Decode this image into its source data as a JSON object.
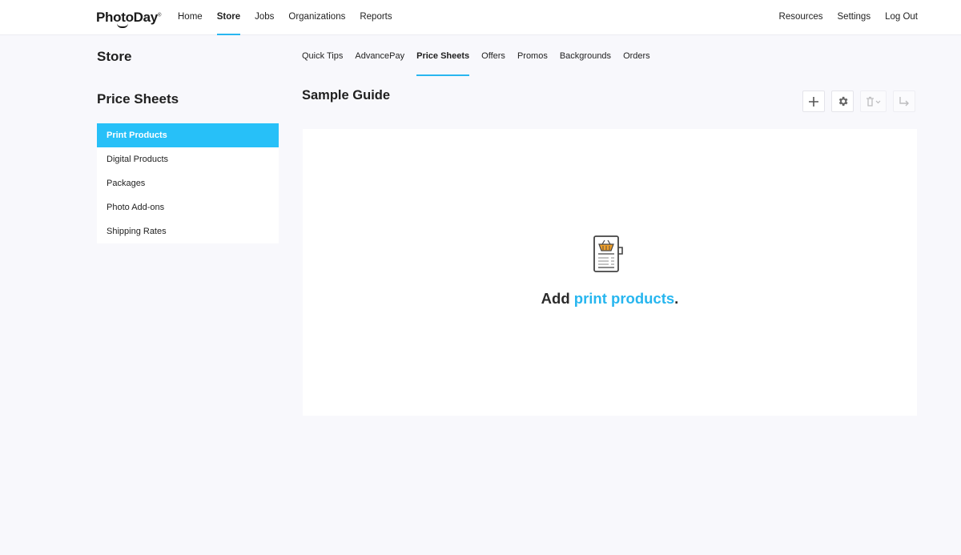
{
  "brand": {
    "name": "PhotoDay",
    "reg": "®"
  },
  "topnav": {
    "main": [
      {
        "label": "Home",
        "active": false
      },
      {
        "label": "Store",
        "active": true
      },
      {
        "label": "Jobs",
        "active": false
      },
      {
        "label": "Organizations",
        "active": false
      },
      {
        "label": "Reports",
        "active": false
      }
    ],
    "right": [
      {
        "label": "Resources"
      },
      {
        "label": "Settings"
      },
      {
        "label": "Log Out"
      }
    ]
  },
  "header": {
    "title": "Store"
  },
  "subnav": [
    {
      "label": "Quick Tips",
      "active": false
    },
    {
      "label": "AdvancePay",
      "active": false
    },
    {
      "label": "Price Sheets",
      "active": true
    },
    {
      "label": "Offers",
      "active": false
    },
    {
      "label": "Promos",
      "active": false
    },
    {
      "label": "Backgrounds",
      "active": false
    },
    {
      "label": "Orders",
      "active": false
    }
  ],
  "sidebar": {
    "title": "Price Sheets",
    "items": [
      {
        "label": "Print Products",
        "active": true
      },
      {
        "label": "Digital Products",
        "active": false
      },
      {
        "label": "Packages",
        "active": false
      },
      {
        "label": "Photo Add-ons",
        "active": false
      },
      {
        "label": "Shipping Rates",
        "active": false
      }
    ]
  },
  "main": {
    "title": "Sample Guide",
    "toolbar": [
      {
        "icon": "plus-icon"
      },
      {
        "icon": "gear-icon"
      },
      {
        "icon": "trash-dropdown-icon",
        "disabled": true
      },
      {
        "icon": "arrow-turn-icon",
        "disabled": true
      }
    ],
    "empty_state": {
      "prefix": "Add ",
      "link": "print products",
      "suffix": "."
    }
  },
  "colors": {
    "accent": "#27c0f8",
    "link": "#27b6ef",
    "background": "#f8f8fc"
  }
}
